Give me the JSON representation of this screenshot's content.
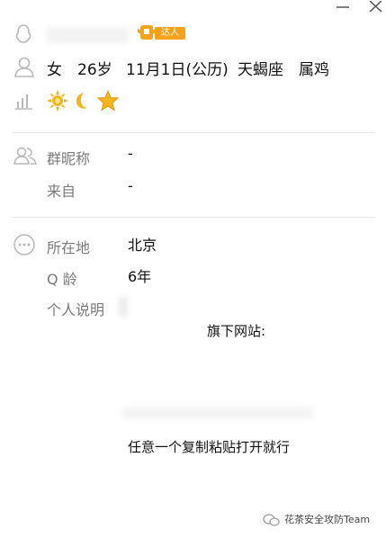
{
  "window": {
    "minimize_icon": "minimize-icon",
    "close_icon": "close-icon"
  },
  "header": {
    "badge_label": "达人"
  },
  "profile": {
    "gender": "女",
    "age": "26岁",
    "birthday": "11月1日(公历)",
    "zodiac": "天蝎座",
    "chinese_zodiac": "属鸡",
    "level_icons": [
      "sun-icon",
      "moon-icon",
      "star-icon"
    ]
  },
  "group_info": {
    "nickname_label": "群昵称",
    "nickname_value": "-",
    "from_label": "来自",
    "from_value": "-"
  },
  "more_info": {
    "location_label": "所在地",
    "location_value": "北京",
    "qage_label": "Q 龄",
    "qage_value": "6年",
    "signature_label": "个人说明",
    "signature_line1": "旗下网站:",
    "signature_line2": "任意一个复制粘贴打开就行"
  },
  "watermark": {
    "text": "花茶安全攻防Team"
  },
  "colors": {
    "badge_orange": "#f7a21b",
    "sun_yellow": "#f5b51c",
    "icon_gray": "#b8b8b8"
  }
}
